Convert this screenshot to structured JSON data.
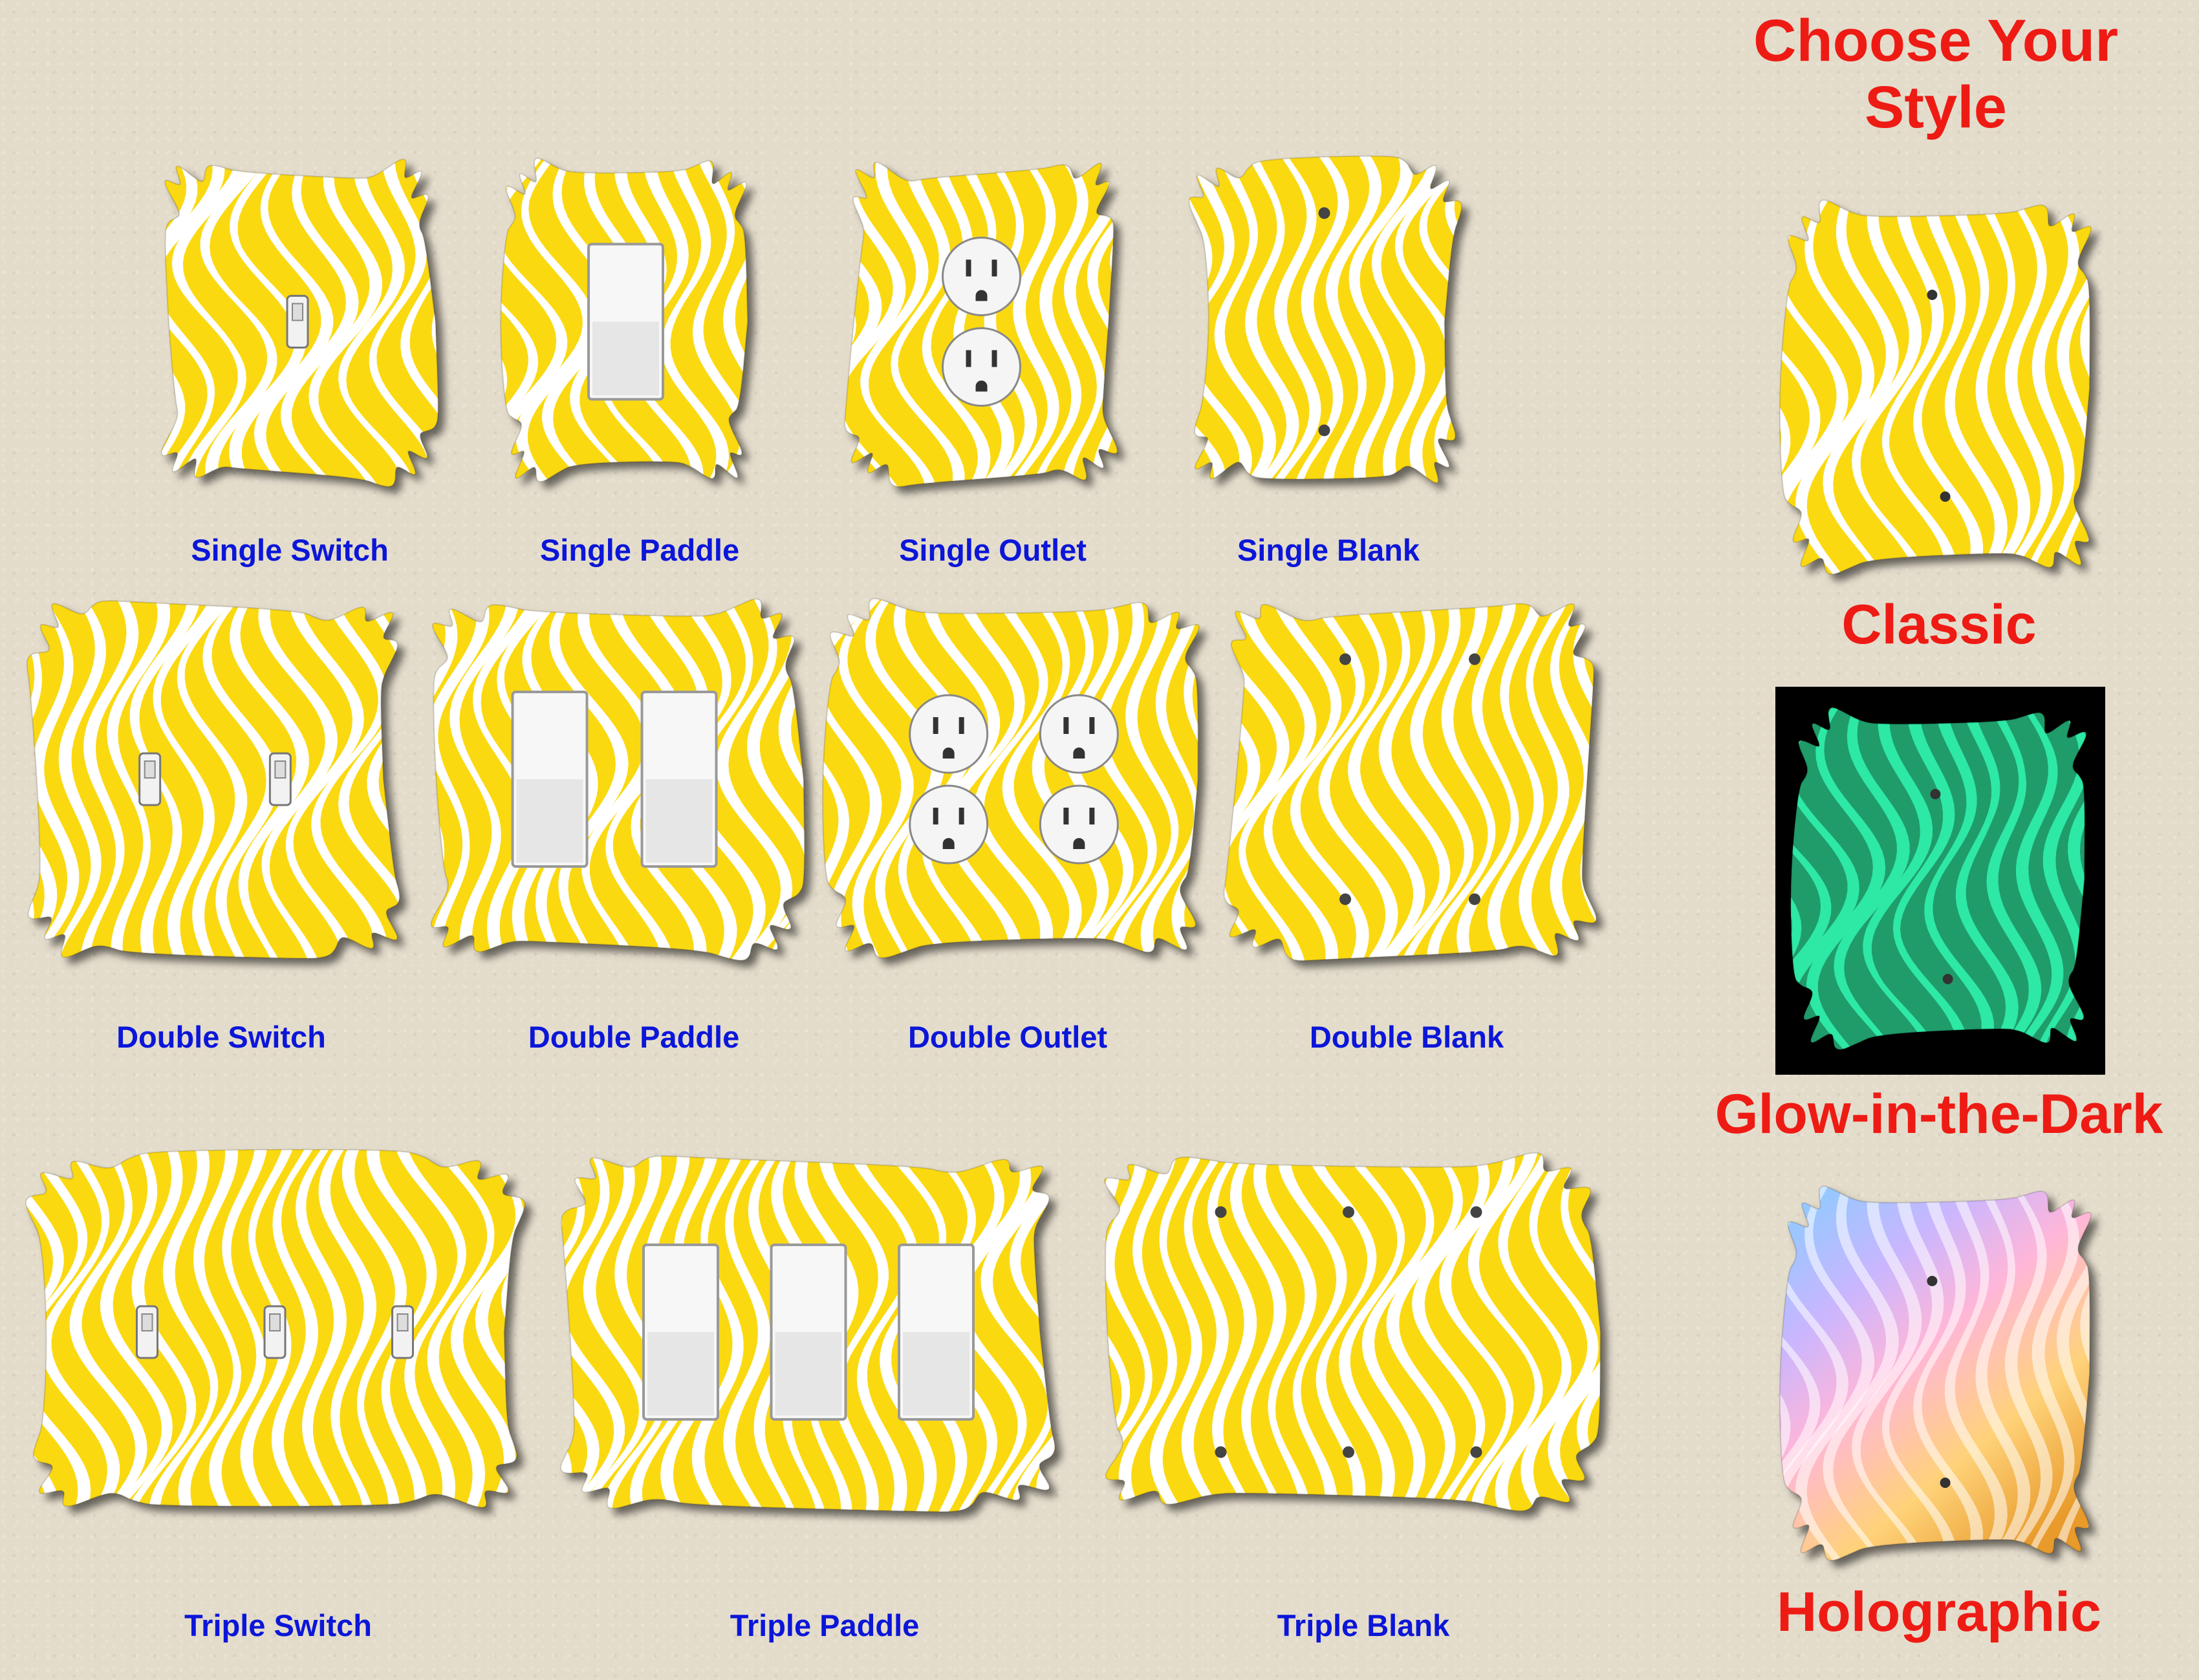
{
  "colors": {
    "plate_base": "#fbd911",
    "plate_stripe": "#ffffff",
    "label_blue": "#0b16d8",
    "heading_red": "#ee1b14",
    "glow_base": "#1f9c6a",
    "glow_stripe": "#2ee8a6"
  },
  "products": [
    {
      "label": "Single Switch",
      "type": "switch",
      "count": 1,
      "icon": "toggle-switch-icon"
    },
    {
      "label": "Single Paddle",
      "type": "paddle",
      "count": 1,
      "icon": "rocker-paddle-icon"
    },
    {
      "label": "Single Outlet",
      "type": "outlet",
      "count": 1,
      "icon": "duplex-outlet-icon"
    },
    {
      "label": "Single Blank",
      "type": "blank",
      "count": 1,
      "icon": "screw-hole-icon"
    },
    {
      "label": "Double Switch",
      "type": "switch",
      "count": 2,
      "icon": "toggle-switch-icon"
    },
    {
      "label": "Double Paddle",
      "type": "paddle",
      "count": 2,
      "icon": "rocker-paddle-icon"
    },
    {
      "label": "Double Outlet",
      "type": "outlet",
      "count": 2,
      "icon": "duplex-outlet-icon"
    },
    {
      "label": "Double Blank",
      "type": "blank",
      "count": 2,
      "icon": "screw-hole-icon"
    },
    {
      "label": "Triple Switch",
      "type": "switch",
      "count": 3,
      "icon": "toggle-switch-icon"
    },
    {
      "label": "Triple Paddle",
      "type": "paddle",
      "count": 3,
      "icon": "rocker-paddle-icon"
    },
    {
      "label": "Triple Blank",
      "type": "blank",
      "count": 3,
      "icon": "screw-hole-icon"
    }
  ],
  "styles": {
    "heading_line1": "Choose Your",
    "heading_line2": "Style",
    "options": [
      {
        "label": "Classic"
      },
      {
        "label": "Glow-in-the-Dark"
      },
      {
        "label": "Holographic"
      }
    ]
  }
}
